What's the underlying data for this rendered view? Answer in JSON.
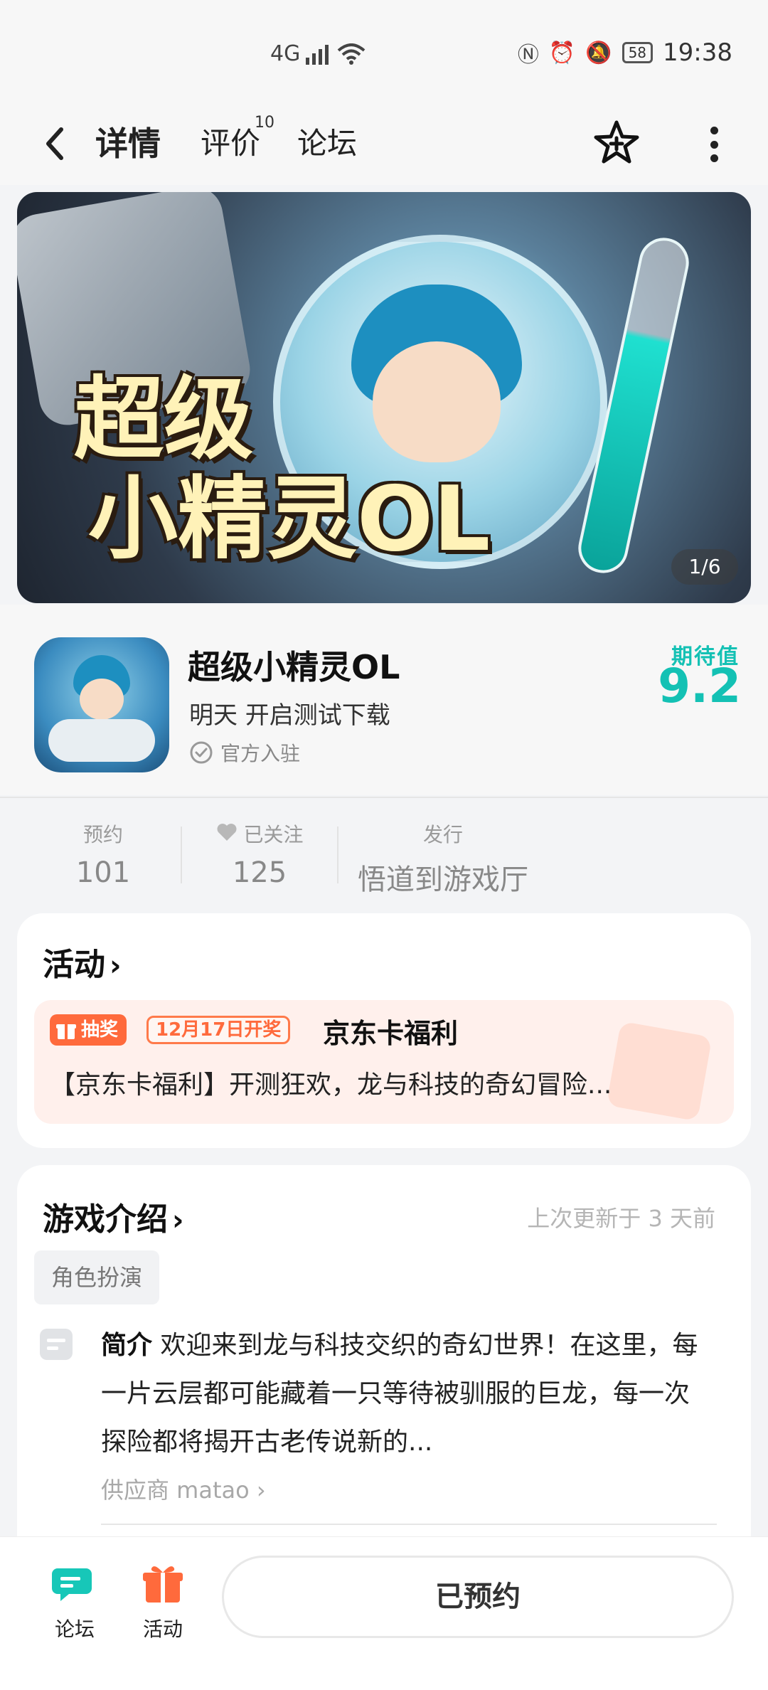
{
  "status_bar": {
    "network": "4G",
    "time": "19:38",
    "battery": "58"
  },
  "nav": {
    "back_icon": "chevron-left-icon",
    "tabs": [
      {
        "label": "详情",
        "active": true
      },
      {
        "label": "评价",
        "badge": "10"
      },
      {
        "label": "论坛"
      }
    ]
  },
  "banner": {
    "title_line1": "超级",
    "title_line2": "小精灵OL",
    "pager": "1/6"
  },
  "game": {
    "name": "超级小精灵OL",
    "release": "明天 开启测试下载",
    "official": "官方入驻",
    "expect_label": "期待值",
    "expect_score": "9.2"
  },
  "stats": [
    {
      "label": "预约",
      "value": "101"
    },
    {
      "label": "已关注",
      "value": "125"
    },
    {
      "label": "发行",
      "value": "悟道到游戏厅"
    }
  ],
  "activity": {
    "title": "活动",
    "tag_lottery": "抽奖",
    "tag_date": "12月17日开奖",
    "event_name": "京东卡福利",
    "event_desc": "【京东卡福利】开测狂欢，龙与科技的奇幻冒险..."
  },
  "intro": {
    "title": "游戏介绍",
    "updated": "上次更新于 3 天前",
    "genre": "角色扮演",
    "summary_label": "简介",
    "summary_text": " 欢迎来到龙与科技交织的奇幻世界！在这里，每一片云层都可能藏着一只等待被驯服的巨龙，每一次探险都将揭开古老传说新的...",
    "supplier": "供应商 matao"
  },
  "bottom_bar": {
    "forum_label": "论坛",
    "activity_label": "活动",
    "reserve_label": "已预约"
  },
  "colors": {
    "accent": "#17d3c3",
    "expect": "#14c1b4",
    "lottery": "#ff6a3c"
  }
}
